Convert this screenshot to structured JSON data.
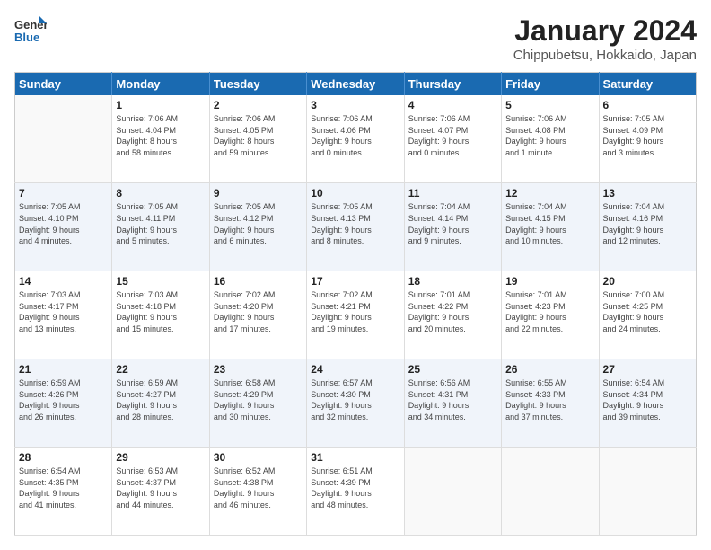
{
  "logo": {
    "line1": "General",
    "line2": "Blue"
  },
  "title": "January 2024",
  "subtitle": "Chippubetsu, Hokkaido, Japan",
  "days_of_week": [
    "Sunday",
    "Monday",
    "Tuesday",
    "Wednesday",
    "Thursday",
    "Friday",
    "Saturday"
  ],
  "weeks": [
    [
      {
        "day": "",
        "info": ""
      },
      {
        "day": "1",
        "info": "Sunrise: 7:06 AM\nSunset: 4:04 PM\nDaylight: 8 hours\nand 58 minutes."
      },
      {
        "day": "2",
        "info": "Sunrise: 7:06 AM\nSunset: 4:05 PM\nDaylight: 8 hours\nand 59 minutes."
      },
      {
        "day": "3",
        "info": "Sunrise: 7:06 AM\nSunset: 4:06 PM\nDaylight: 9 hours\nand 0 minutes."
      },
      {
        "day": "4",
        "info": "Sunrise: 7:06 AM\nSunset: 4:07 PM\nDaylight: 9 hours\nand 0 minutes."
      },
      {
        "day": "5",
        "info": "Sunrise: 7:06 AM\nSunset: 4:08 PM\nDaylight: 9 hours\nand 1 minute."
      },
      {
        "day": "6",
        "info": "Sunrise: 7:05 AM\nSunset: 4:09 PM\nDaylight: 9 hours\nand 3 minutes."
      }
    ],
    [
      {
        "day": "7",
        "info": "Sunrise: 7:05 AM\nSunset: 4:10 PM\nDaylight: 9 hours\nand 4 minutes."
      },
      {
        "day": "8",
        "info": "Sunrise: 7:05 AM\nSunset: 4:11 PM\nDaylight: 9 hours\nand 5 minutes."
      },
      {
        "day": "9",
        "info": "Sunrise: 7:05 AM\nSunset: 4:12 PM\nDaylight: 9 hours\nand 6 minutes."
      },
      {
        "day": "10",
        "info": "Sunrise: 7:05 AM\nSunset: 4:13 PM\nDaylight: 9 hours\nand 8 minutes."
      },
      {
        "day": "11",
        "info": "Sunrise: 7:04 AM\nSunset: 4:14 PM\nDaylight: 9 hours\nand 9 minutes."
      },
      {
        "day": "12",
        "info": "Sunrise: 7:04 AM\nSunset: 4:15 PM\nDaylight: 9 hours\nand 10 minutes."
      },
      {
        "day": "13",
        "info": "Sunrise: 7:04 AM\nSunset: 4:16 PM\nDaylight: 9 hours\nand 12 minutes."
      }
    ],
    [
      {
        "day": "14",
        "info": "Sunrise: 7:03 AM\nSunset: 4:17 PM\nDaylight: 9 hours\nand 13 minutes."
      },
      {
        "day": "15",
        "info": "Sunrise: 7:03 AM\nSunset: 4:18 PM\nDaylight: 9 hours\nand 15 minutes."
      },
      {
        "day": "16",
        "info": "Sunrise: 7:02 AM\nSunset: 4:20 PM\nDaylight: 9 hours\nand 17 minutes."
      },
      {
        "day": "17",
        "info": "Sunrise: 7:02 AM\nSunset: 4:21 PM\nDaylight: 9 hours\nand 19 minutes."
      },
      {
        "day": "18",
        "info": "Sunrise: 7:01 AM\nSunset: 4:22 PM\nDaylight: 9 hours\nand 20 minutes."
      },
      {
        "day": "19",
        "info": "Sunrise: 7:01 AM\nSunset: 4:23 PM\nDaylight: 9 hours\nand 22 minutes."
      },
      {
        "day": "20",
        "info": "Sunrise: 7:00 AM\nSunset: 4:25 PM\nDaylight: 9 hours\nand 24 minutes."
      }
    ],
    [
      {
        "day": "21",
        "info": "Sunrise: 6:59 AM\nSunset: 4:26 PM\nDaylight: 9 hours\nand 26 minutes."
      },
      {
        "day": "22",
        "info": "Sunrise: 6:59 AM\nSunset: 4:27 PM\nDaylight: 9 hours\nand 28 minutes."
      },
      {
        "day": "23",
        "info": "Sunrise: 6:58 AM\nSunset: 4:29 PM\nDaylight: 9 hours\nand 30 minutes."
      },
      {
        "day": "24",
        "info": "Sunrise: 6:57 AM\nSunset: 4:30 PM\nDaylight: 9 hours\nand 32 minutes."
      },
      {
        "day": "25",
        "info": "Sunrise: 6:56 AM\nSunset: 4:31 PM\nDaylight: 9 hours\nand 34 minutes."
      },
      {
        "day": "26",
        "info": "Sunrise: 6:55 AM\nSunset: 4:33 PM\nDaylight: 9 hours\nand 37 minutes."
      },
      {
        "day": "27",
        "info": "Sunrise: 6:54 AM\nSunset: 4:34 PM\nDaylight: 9 hours\nand 39 minutes."
      }
    ],
    [
      {
        "day": "28",
        "info": "Sunrise: 6:54 AM\nSunset: 4:35 PM\nDaylight: 9 hours\nand 41 minutes."
      },
      {
        "day": "29",
        "info": "Sunrise: 6:53 AM\nSunset: 4:37 PM\nDaylight: 9 hours\nand 44 minutes."
      },
      {
        "day": "30",
        "info": "Sunrise: 6:52 AM\nSunset: 4:38 PM\nDaylight: 9 hours\nand 46 minutes."
      },
      {
        "day": "31",
        "info": "Sunrise: 6:51 AM\nSunset: 4:39 PM\nDaylight: 9 hours\nand 48 minutes."
      },
      {
        "day": "",
        "info": ""
      },
      {
        "day": "",
        "info": ""
      },
      {
        "day": "",
        "info": ""
      }
    ]
  ]
}
